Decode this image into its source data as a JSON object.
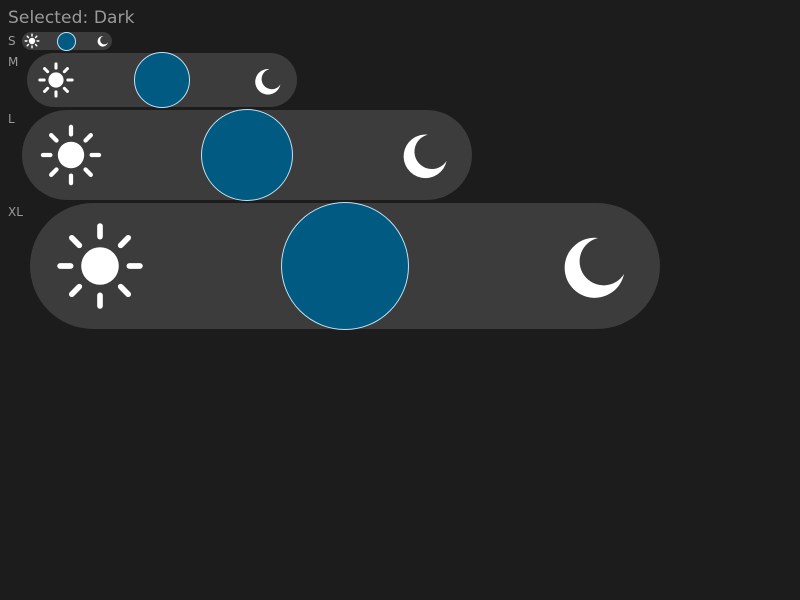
{
  "status": {
    "selected_text": "Selected: Dark"
  },
  "sizes": [
    {
      "key": "s",
      "label": "S"
    },
    {
      "key": "m",
      "label": "M"
    },
    {
      "key": "l",
      "label": "L"
    },
    {
      "key": "xl",
      "label": "XL"
    }
  ],
  "toggle": {
    "options": [
      "Light",
      "Dark"
    ],
    "selected": "Dark",
    "light_icon": "sun-icon",
    "dark_icon": "moon-icon",
    "middle_state": "knob-centered"
  },
  "colors": {
    "background": "#1c1c1c",
    "track": "#3c3c3c",
    "knob": "#015a82",
    "knob_border": "#bfe3f2",
    "icon": "#ffffff",
    "label_text": "#9a9a9a"
  }
}
